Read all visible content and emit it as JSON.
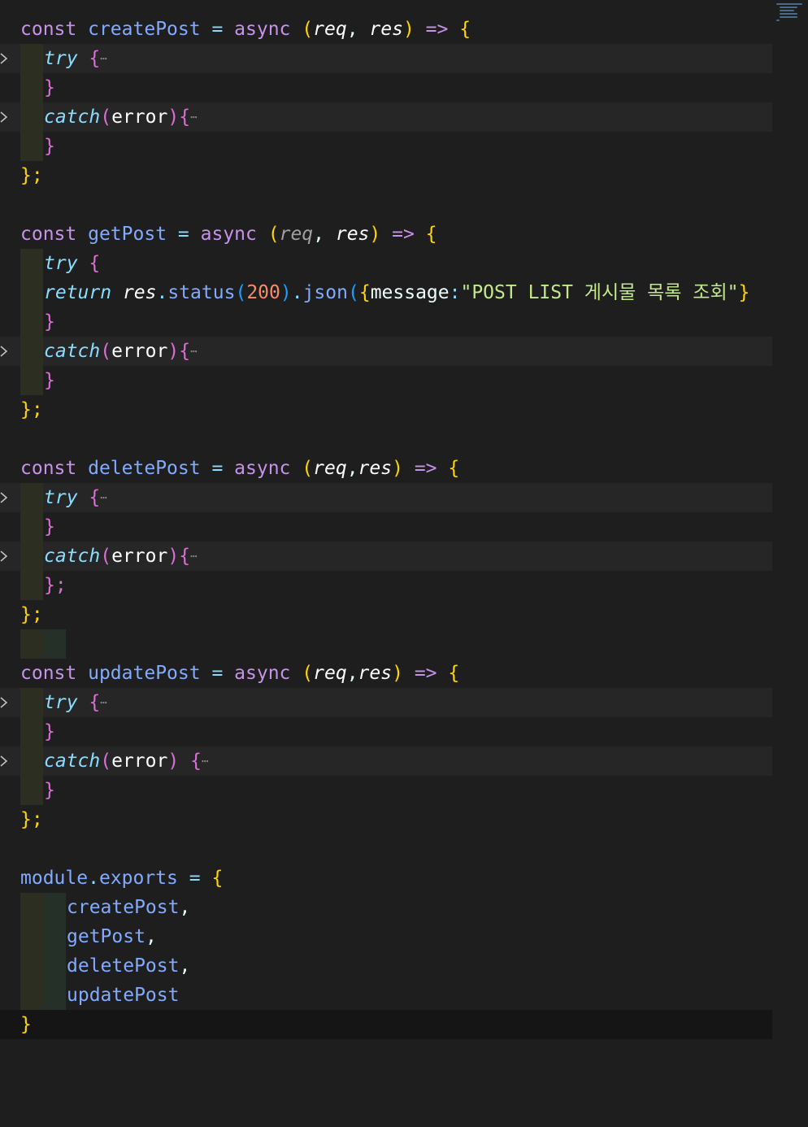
{
  "editor": {
    "language": "javascript",
    "functions": [
      {
        "name": "createPost",
        "params": [
          "req",
          "res"
        ]
      },
      {
        "name": "getPost",
        "params": [
          "req",
          "res"
        ]
      },
      {
        "name": "deletePost",
        "params": [
          "req",
          "res"
        ]
      },
      {
        "name": "updatePost",
        "params": [
          "req",
          "res"
        ]
      }
    ],
    "tokens": {
      "const": "const",
      "async": "async",
      "arrow": "=>",
      "eq": "=",
      "try": "try",
      "catch": "catch",
      "error": "error",
      "return": "return",
      "req": "req",
      "res": "res",
      "status": "status",
      "status_code": "200",
      "json": "json",
      "message_key": "message",
      "message_value": "\"POST LIST 게시물 목록 조회\"",
      "module": "module",
      "exports": "exports",
      "export_names": [
        "createPost",
        "getPost",
        "deletePost",
        "updatePost"
      ],
      "ellipsis": "⋯",
      "close_brace_semi": "};",
      "close_brace": "}"
    }
  },
  "minimap": {
    "visible": true
  },
  "colors": {
    "background": "#1e1e1e",
    "keyword": "#c792ea",
    "function": "#82aaff",
    "bracket_level1": "#ffd700",
    "bracket_level2": "#da70d6",
    "string": "#c3e88d",
    "number": "#f78c6c"
  }
}
